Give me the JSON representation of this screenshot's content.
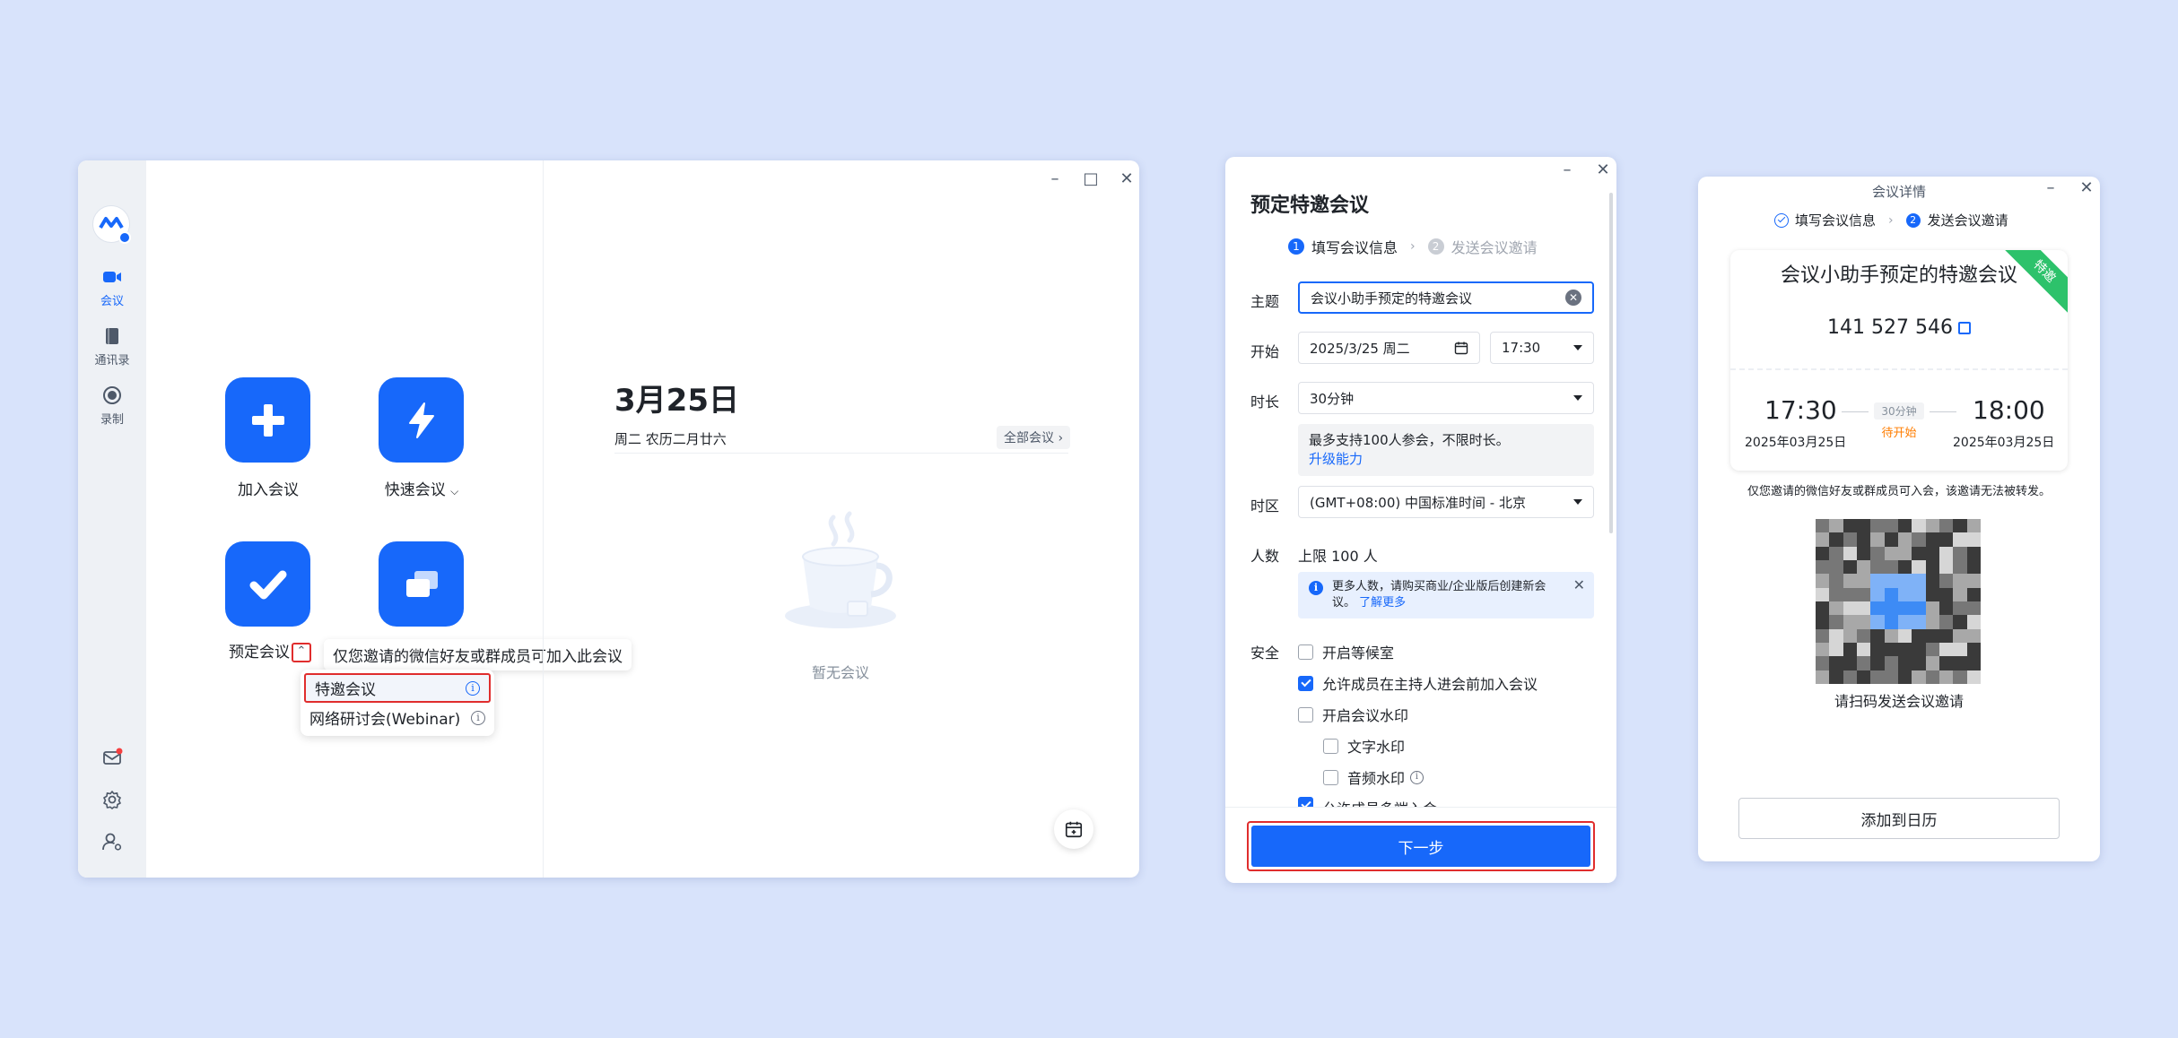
{
  "main": {
    "sidebar": {
      "items": [
        {
          "label": "会议",
          "icon": "video-icon",
          "active": true
        },
        {
          "label": "通讯录",
          "icon": "contacts-icon"
        },
        {
          "label": "录制",
          "icon": "record-icon"
        }
      ],
      "bottom_icons": [
        "mail-icon",
        "gear-icon",
        "user-settings-icon"
      ]
    },
    "actions": {
      "join": "加入会议",
      "quick": "快速会议",
      "schedule": "预定会议",
      "share": ""
    },
    "tooltip": "仅您邀请的微信好友或群成员可加入此会议",
    "dropdown": [
      {
        "label": "特邀会议",
        "highlighted": true
      },
      {
        "label": "网络研讨会(Webinar)",
        "highlighted": false
      }
    ],
    "date_title": "3月25日",
    "date_sub": "周二 农历二月廿六",
    "all_meetings": "全部会议",
    "empty": "暂无会议",
    "accent": "#1768fa",
    "highlight_color": "#e02d2d"
  },
  "form": {
    "title": "预定特邀会议",
    "step1": "填写会议信息",
    "step2": "发送会议邀请",
    "labels": {
      "topic": "主题",
      "start": "开始",
      "duration": "时长",
      "timezone": "时区",
      "people": "人数",
      "security": "安全"
    },
    "topic_value": "会议小助手预定的特邀会议",
    "start_date": "2025/3/25 周二",
    "start_time": "17:30",
    "duration_value": "30分钟",
    "duration_note": "最多支持100人参会，不限时长。",
    "upgrade": "升级能力",
    "timezone_value": "(GMT+08:00) 中国标准时间 - 北京",
    "people_value": "上限 100 人",
    "people_info": "更多人数，请购买商业/企业版后创建新会议。",
    "learn_more": "了解更多",
    "security": [
      {
        "label": "开启等候室",
        "checked": false
      },
      {
        "label": "允许成员在主持人进会前加入会议",
        "checked": true
      },
      {
        "label": "开启会议水印",
        "checked": false
      },
      {
        "label": "文字水印",
        "checked": false
      },
      {
        "label": "音频水印",
        "checked": false
      },
      {
        "label": "允许成员多端入会",
        "checked": true
      }
    ],
    "next": "下一步"
  },
  "details": {
    "window_title": "会议详情",
    "step1": "填写会议信息",
    "step2": "发送会议邀请",
    "meeting_title": "会议小助手预定的特邀会议",
    "ribbon": "特邀",
    "meeting_id": "141 527 546",
    "start_time": "17:30",
    "start_date": "2025年03月25日",
    "end_time": "18:00",
    "end_date": "2025年03月25日",
    "duration": "30分钟",
    "status": "待开始",
    "share_note": "仅您邀请的微信好友或群成员可入会，该邀请无法被转发。",
    "scan_text": "请扫码发送会议邀请",
    "add_calendar": "添加到日历"
  }
}
